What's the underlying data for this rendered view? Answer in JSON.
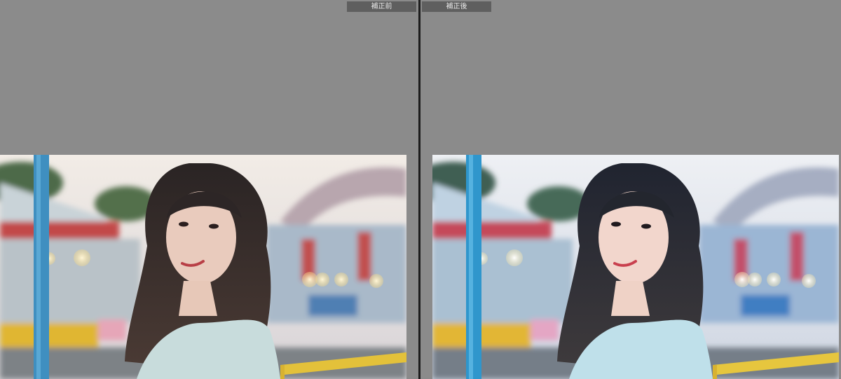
{
  "view": {
    "before_label": "補正前",
    "after_label": "補正後"
  },
  "images": {
    "before": {
      "description_icon": "photo-before"
    },
    "after": {
      "description_icon": "photo-after"
    }
  },
  "colors": {
    "background": "#8b8b8b",
    "label_bg": "#5f5f5f",
    "divider": "#1d1d1d"
  }
}
